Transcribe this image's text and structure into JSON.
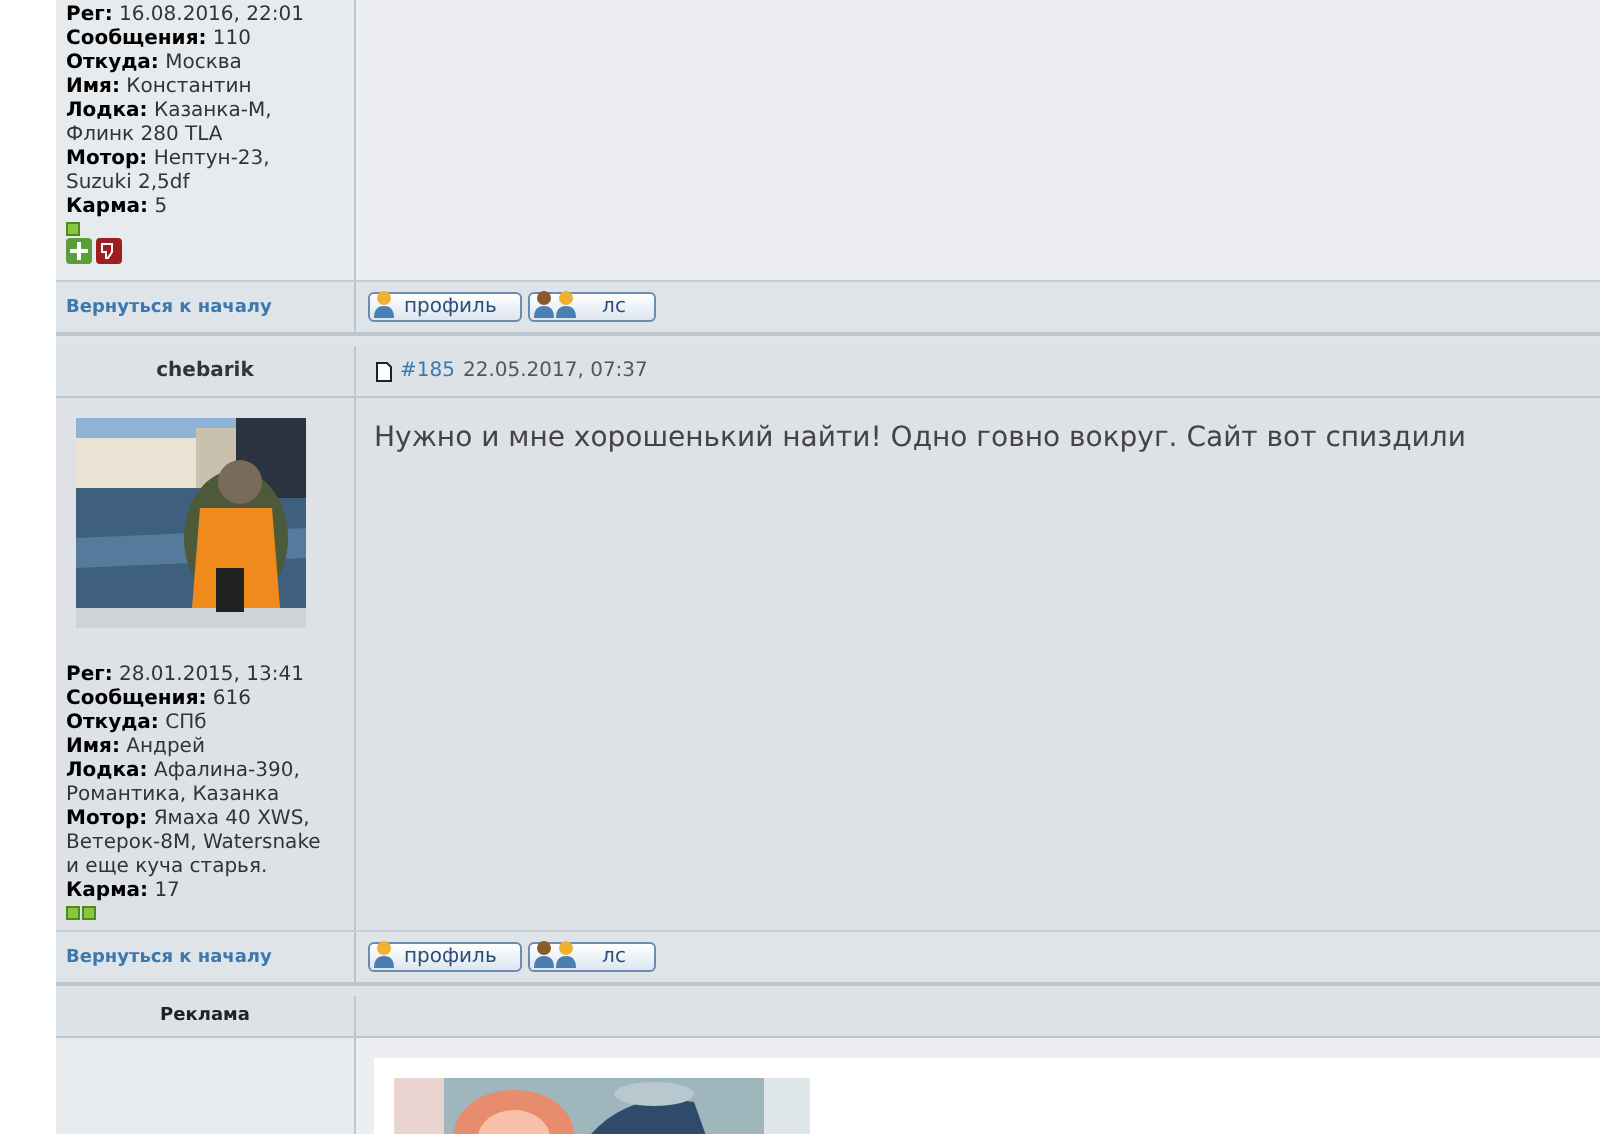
{
  "posts": [
    {
      "author_fields": [
        {
          "label": "Рег:",
          "value": "16.08.2016, 22:01"
        },
        {
          "label": "Сообщения:",
          "value": "110"
        },
        {
          "label": "Откуда:",
          "value": "Москва"
        },
        {
          "label": "Имя:",
          "value": "Константин"
        },
        {
          "label": "Лодка:",
          "value": "Казанка-М, Флинк 280 TLA"
        },
        {
          "label": "Мотор:",
          "value": "Нептун-23, Suzuki 2,5df"
        },
        {
          "label": "Карма:",
          "value": "5"
        }
      ],
      "karma_squares": [
        {
          "kind": "square"
        }
      ],
      "vote_buttons": true,
      "back_link": "Вернуться к началу",
      "buttons": [
        {
          "kind": "profile",
          "label": "профиль"
        },
        {
          "kind": "pm",
          "label": "лс"
        }
      ]
    },
    {
      "author": "chebarik",
      "post_number": "#185",
      "date": "22.05.2017, 07:37",
      "message": "Нужно и мне хорошенький найти! Одно говно вокруг. Сайт вот спиздили",
      "author_fields": [
        {
          "label": "Рег:",
          "value": "28.01.2015, 13:41"
        },
        {
          "label": "Сообщения:",
          "value": "616"
        },
        {
          "label": "Откуда:",
          "value": "СПб"
        },
        {
          "label": "Имя:",
          "value": "Андрей"
        },
        {
          "label": "Лодка:",
          "value": "Афалина-390, Романтика, Казанка"
        },
        {
          "label": "Мотор:",
          "value": "Ямаха 40 XWS, Ветерок-8М, Watersnake и еще куча старья."
        },
        {
          "label": "Карма:",
          "value": "17"
        }
      ],
      "karma_squares": [
        {
          "kind": "square"
        },
        {
          "kind": "square"
        }
      ],
      "vote_buttons": false,
      "back_link": "Вернуться к началу",
      "buttons": [
        {
          "kind": "profile",
          "label": "профиль"
        },
        {
          "kind": "pm",
          "label": "лс"
        }
      ]
    }
  ],
  "ad": {
    "title": "Реклама"
  }
}
